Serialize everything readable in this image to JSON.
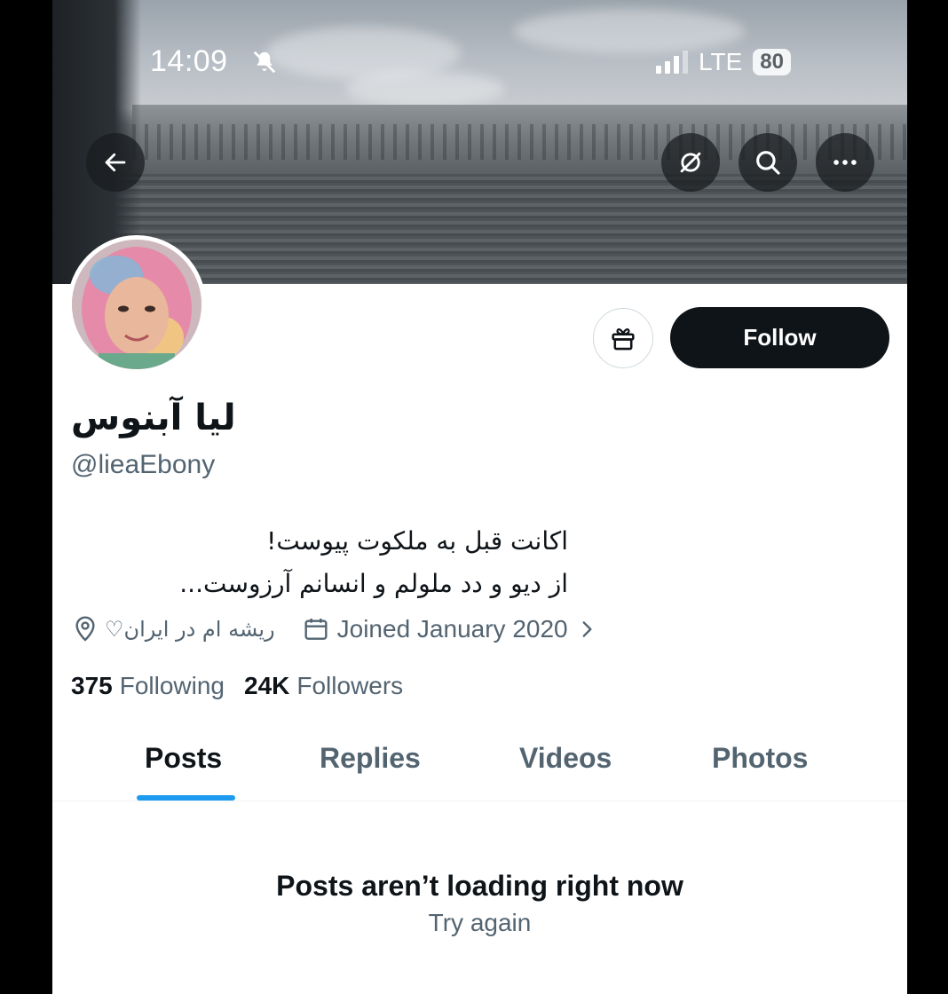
{
  "status_bar": {
    "time": "14:09",
    "network": "LTE",
    "battery": "80"
  },
  "header": {
    "back_icon": "arrow-left-icon",
    "icons": [
      "no-translate-icon",
      "search-icon",
      "more-icon"
    ]
  },
  "profile": {
    "display_name": "لیا آبنوس",
    "handle": "@lieaEbony",
    "bio_lines": [
      "اکانت قبل به ملکوت پیوست!",
      "از دیو و دد ملولم و انسانم آرزوست..."
    ],
    "location": "ریشه ام در ایران♡",
    "joined": "Joined January 2020",
    "following_count": "375",
    "following_label": "Following",
    "followers_count": "24K",
    "followers_label": "Followers",
    "follow_button": "Follow"
  },
  "tabs": [
    {
      "label": "Posts",
      "active": true
    },
    {
      "label": "Replies",
      "active": false
    },
    {
      "label": "Videos",
      "active": false
    },
    {
      "label": "Photos",
      "active": false
    }
  ],
  "content": {
    "empty_title": "Posts aren’t loading right now",
    "retry_label": "Try again"
  },
  "colors": {
    "accent": "#1d9bf0",
    "text_primary": "#0f1419",
    "text_secondary": "#536471",
    "follow_bg": "#0f1419"
  }
}
